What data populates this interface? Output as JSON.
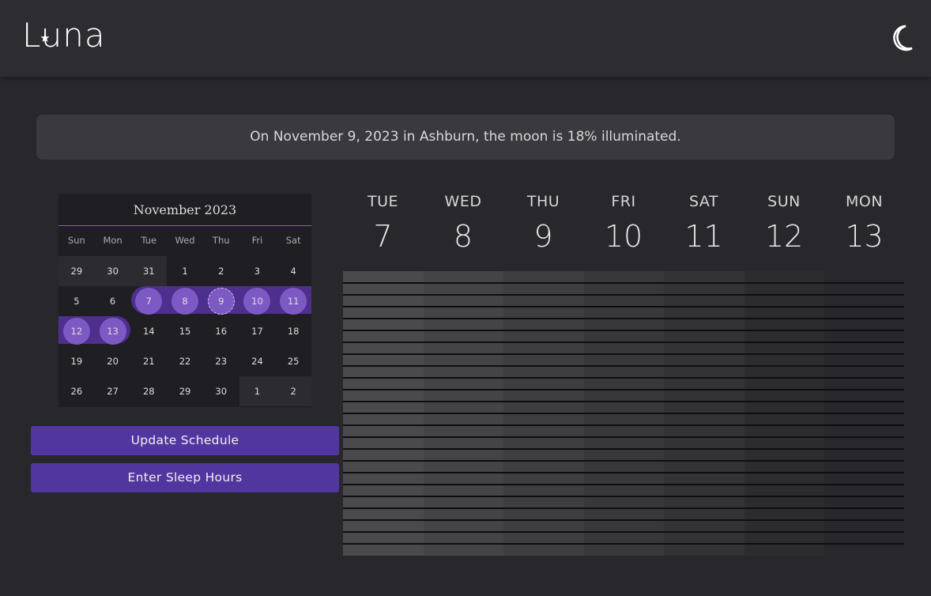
{
  "app": {
    "name": "Luna"
  },
  "header": {
    "theme_icon": "crescent-moon-icon"
  },
  "banner": {
    "text": "On November 9, 2023 in Ashburn, the moon is 18% illuminated."
  },
  "calendar": {
    "title": "November 2023",
    "weekdays": [
      "Sun",
      "Mon",
      "Tue",
      "Wed",
      "Thu",
      "Fri",
      "Sat"
    ],
    "weeks": [
      [
        "29",
        "30",
        "31",
        "1",
        "2",
        "3",
        "4"
      ],
      [
        "5",
        "6",
        "7",
        "8",
        "9",
        "10",
        "11"
      ],
      [
        "12",
        "13",
        "14",
        "15",
        "16",
        "17",
        "18"
      ],
      [
        "19",
        "20",
        "21",
        "22",
        "23",
        "24",
        "25"
      ],
      [
        "26",
        "27",
        "28",
        "29",
        "30",
        "1",
        "2"
      ]
    ],
    "selected_range": [
      "7",
      "8",
      "9",
      "10",
      "11",
      "12",
      "13"
    ],
    "today": "9"
  },
  "buttons": {
    "update": "Update Schedule",
    "sleep": "Enter Sleep Hours"
  },
  "week_view": {
    "days": [
      {
        "name": "TUE",
        "num": "7"
      },
      {
        "name": "WED",
        "num": "8"
      },
      {
        "name": "THU",
        "num": "9"
      },
      {
        "name": "FRI",
        "num": "10"
      },
      {
        "name": "SAT",
        "num": "11"
      },
      {
        "name": "SUN",
        "num": "12"
      },
      {
        "name": "MON",
        "num": "13"
      }
    ],
    "column_colors": [
      "#4a4a4d",
      "#444447",
      "#3e3e41",
      "#38383b",
      "#333336",
      "#2c2c2f",
      "#28272c"
    ]
  },
  "colors": {
    "accent": "#5236a0",
    "accent_light": "#7d59c4",
    "range_band": "#4d2f8e",
    "background": "#28272c"
  }
}
